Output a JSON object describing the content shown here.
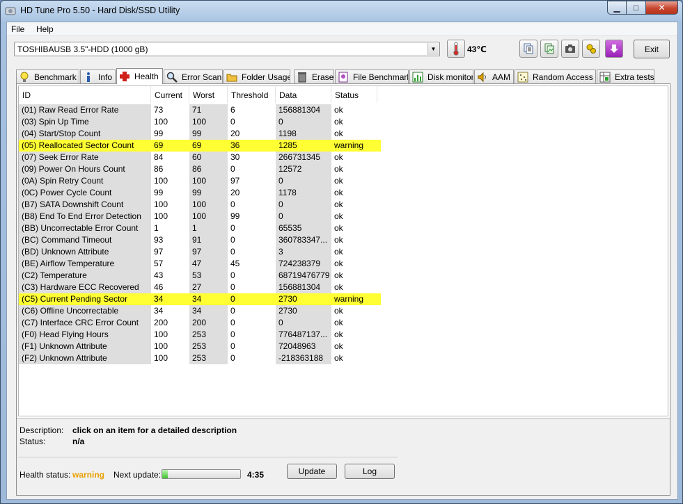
{
  "window": {
    "title": "HD Tune Pro 5.50 - Hard Disk/SSD Utility",
    "minimize": "▁",
    "maximize": "□",
    "close": "✕"
  },
  "menu": {
    "file": "File",
    "help": "Help"
  },
  "toolbar": {
    "drive": "TOSHIBAUSB 3.5\"-HDD (1000 gB)",
    "temperature": "43℃",
    "exit": "Exit",
    "icons": [
      "copy-text-icon",
      "copy-image-icon",
      "camera-icon",
      "options-icon",
      "save-icon"
    ]
  },
  "tabs": [
    {
      "label": "Benchmark",
      "icon": "lightbulb-icon"
    },
    {
      "label": "Info",
      "icon": "info-icon"
    },
    {
      "label": "Health",
      "icon": "health-cross-icon"
    },
    {
      "label": "Error Scan",
      "icon": "magnifier-icon"
    },
    {
      "label": "Folder Usage",
      "icon": "folder-icon"
    },
    {
      "label": "Erase",
      "icon": "trash-icon"
    },
    {
      "label": "File Benchmark",
      "icon": "file-benchmark-icon"
    },
    {
      "label": "Disk monitor",
      "icon": "disk-monitor-icon"
    },
    {
      "label": "AAM",
      "icon": "speaker-icon"
    },
    {
      "label": "Random Access",
      "icon": "random-access-icon"
    },
    {
      "label": "Extra tests",
      "icon": "extra-tests-icon"
    }
  ],
  "active_tab": "Health",
  "columns": [
    "ID",
    "Current",
    "Worst",
    "Threshold",
    "Data",
    "Status"
  ],
  "rows": [
    {
      "id": "(01) Raw Read Error Rate",
      "current": "73",
      "worst": "71",
      "threshold": "6",
      "data": "156881304",
      "status": "ok"
    },
    {
      "id": "(03) Spin Up Time",
      "current": "100",
      "worst": "100",
      "threshold": "0",
      "data": "0",
      "status": "ok"
    },
    {
      "id": "(04) Start/Stop Count",
      "current": "99",
      "worst": "99",
      "threshold": "20",
      "data": "1198",
      "status": "ok"
    },
    {
      "id": "(05) Reallocated Sector Count",
      "current": "69",
      "worst": "69",
      "threshold": "36",
      "data": "1285",
      "status": "warning"
    },
    {
      "id": "(07) Seek Error Rate",
      "current": "84",
      "worst": "60",
      "threshold": "30",
      "data": "266731345",
      "status": "ok"
    },
    {
      "id": "(09) Power On Hours Count",
      "current": "86",
      "worst": "86",
      "threshold": "0",
      "data": "12572",
      "status": "ok"
    },
    {
      "id": "(0A) Spin Retry Count",
      "current": "100",
      "worst": "100",
      "threshold": "97",
      "data": "0",
      "status": "ok"
    },
    {
      "id": "(0C) Power Cycle Count",
      "current": "99",
      "worst": "99",
      "threshold": "20",
      "data": "1178",
      "status": "ok"
    },
    {
      "id": "(B7) SATA Downshift Count",
      "current": "100",
      "worst": "100",
      "threshold": "0",
      "data": "0",
      "status": "ok"
    },
    {
      "id": "(B8) End To End Error Detection",
      "current": "100",
      "worst": "100",
      "threshold": "99",
      "data": "0",
      "status": "ok"
    },
    {
      "id": "(BB) Uncorrectable Error Count",
      "current": "1",
      "worst": "1",
      "threshold": "0",
      "data": "65535",
      "status": "ok"
    },
    {
      "id": "(BC) Command Timeout",
      "current": "93",
      "worst": "91",
      "threshold": "0",
      "data": "360783347...",
      "status": "ok"
    },
    {
      "id": "(BD) Unknown Attribute",
      "current": "97",
      "worst": "97",
      "threshold": "0",
      "data": "3",
      "status": "ok"
    },
    {
      "id": "(BE) Airflow Temperature",
      "current": "57",
      "worst": "47",
      "threshold": "45",
      "data": "724238379",
      "status": "ok"
    },
    {
      "id": "(C2) Temperature",
      "current": "43",
      "worst": "53",
      "threshold": "0",
      "data": "68719476779",
      "status": "ok"
    },
    {
      "id": "(C3) Hardware ECC Recovered",
      "current": "46",
      "worst": "27",
      "threshold": "0",
      "data": "156881304",
      "status": "ok"
    },
    {
      "id": "(C5) Current Pending Sector",
      "current": "34",
      "worst": "34",
      "threshold": "0",
      "data": "2730",
      "status": "warning"
    },
    {
      "id": "(C6) Offline Uncorrectable",
      "current": "34",
      "worst": "34",
      "threshold": "0",
      "data": "2730",
      "status": "ok"
    },
    {
      "id": "(C7) Interface CRC Error Count",
      "current": "200",
      "worst": "200",
      "threshold": "0",
      "data": "0",
      "status": "ok"
    },
    {
      "id": "(F0) Head Flying Hours",
      "current": "100",
      "worst": "253",
      "threshold": "0",
      "data": "776487137...",
      "status": "ok"
    },
    {
      "id": "(F1) Unknown Attribute",
      "current": "100",
      "worst": "253",
      "threshold": "0",
      "data": "72048963",
      "status": "ok"
    },
    {
      "id": "(F2) Unknown Attribute",
      "current": "100",
      "worst": "253",
      "threshold": "0",
      "data": "-218363188",
      "status": "ok"
    }
  ],
  "description": {
    "desc_label": "Description:",
    "desc_value": "click on an item for a detailed description",
    "status_label": "Status:",
    "status_value": "n/a"
  },
  "footer": {
    "health_label": "Health status:",
    "health_value": "warning",
    "next_update_label": "Next update:",
    "progress_fraction": 0.07,
    "countdown": "4:35",
    "update_button": "Update",
    "log_button": "Log"
  },
  "colors": {
    "warning_row": "#ffff33",
    "health_warning_text": "#e8a000",
    "progress_fill": "#3fc42b"
  }
}
